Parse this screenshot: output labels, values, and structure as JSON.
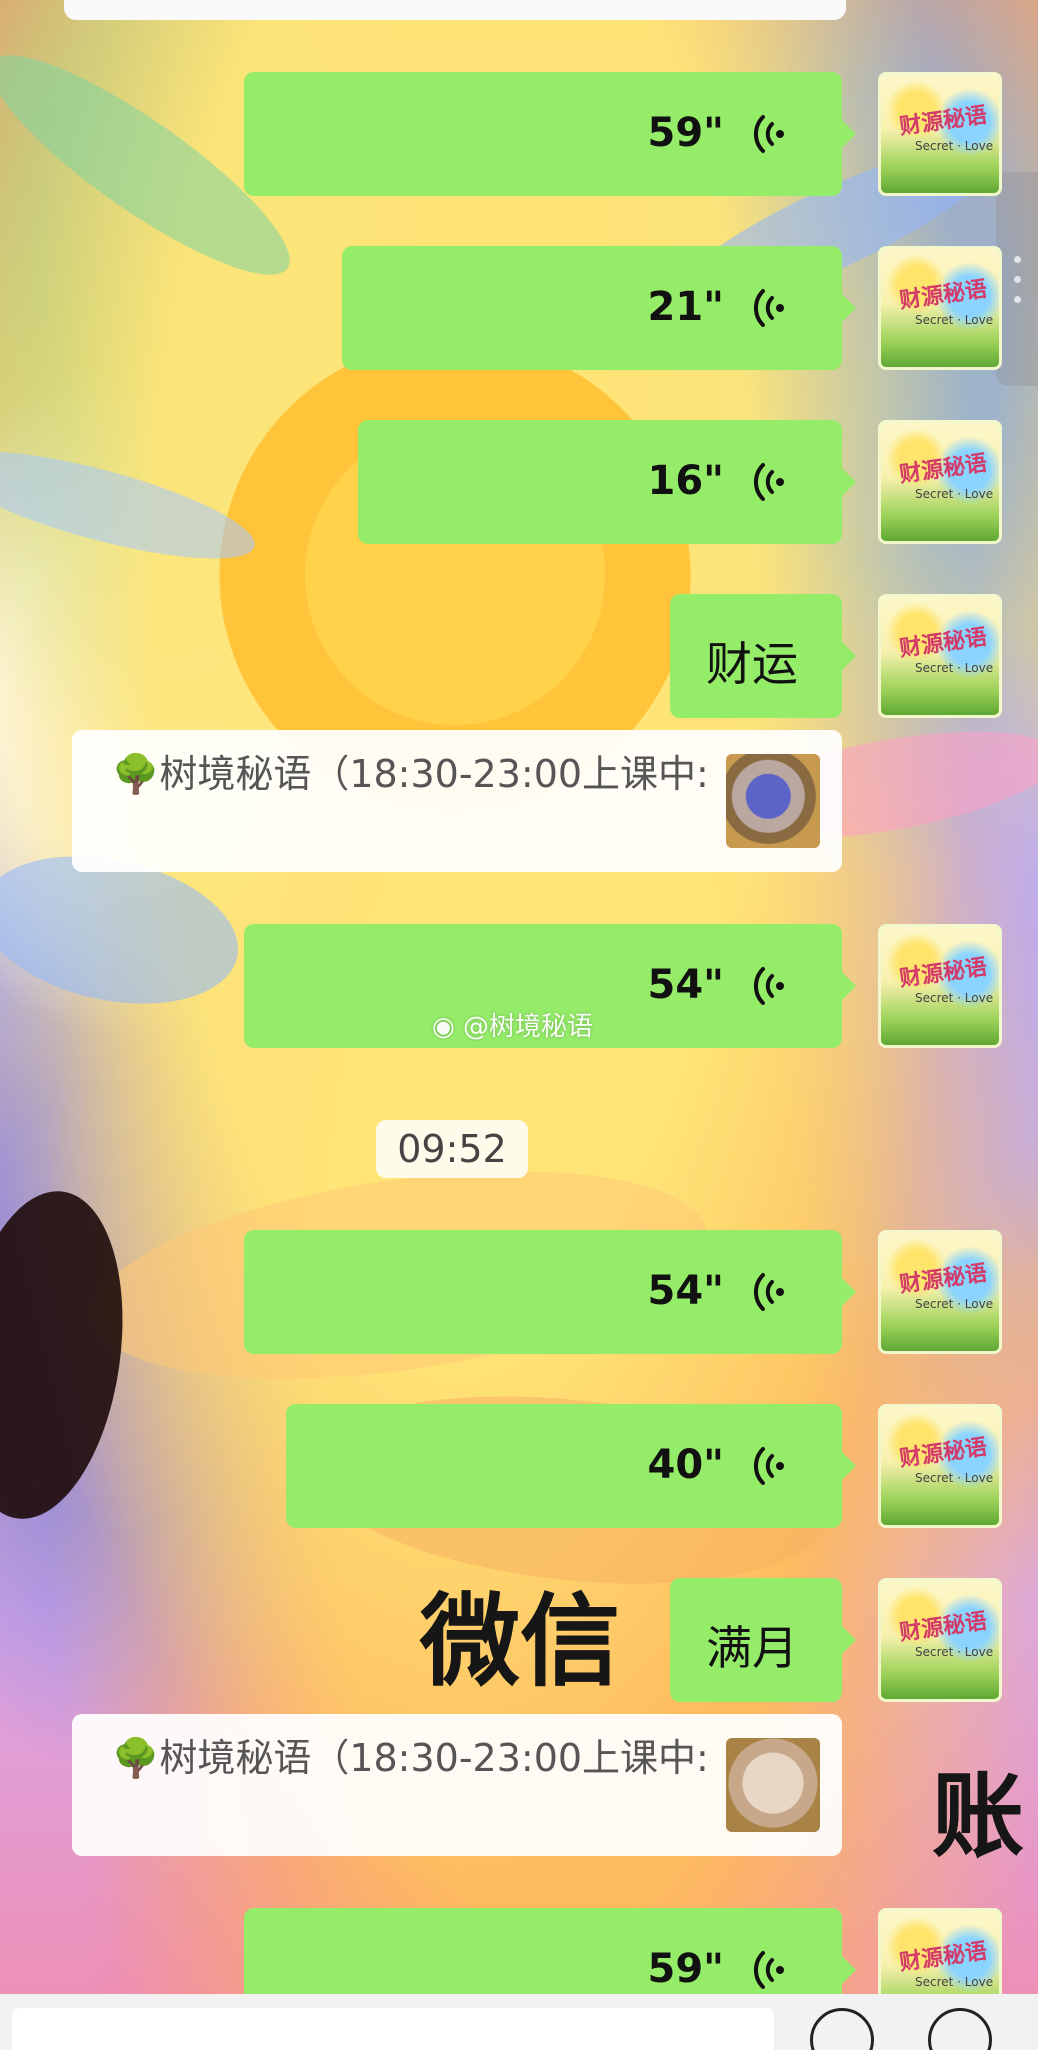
{
  "chat": {
    "messages": [
      {
        "type": "voice",
        "duration": "59\""
      },
      {
        "type": "voice",
        "duration": "21\""
      },
      {
        "type": "voice",
        "duration": "16\""
      },
      {
        "type": "text",
        "text": "财运"
      },
      {
        "type": "quote",
        "text": "🌳树境秘语（18:30-23:00上课中:"
      },
      {
        "type": "voice",
        "duration": "54\""
      },
      {
        "type": "time",
        "text": "09:52"
      },
      {
        "type": "voice",
        "duration": "54\""
      },
      {
        "type": "voice",
        "duration": "40\""
      },
      {
        "type": "text",
        "text": "满月"
      },
      {
        "type": "quote",
        "text": "🌳树境秘语（18:30-23:00上课中:"
      },
      {
        "type": "voice",
        "duration": "59\""
      }
    ],
    "voice_icon": "voice-wave-icon",
    "avatar_icon": "user-avatar"
  },
  "watermark": {
    "text": "@树境秘语"
  },
  "background_overlay": {
    "text_left": "微信",
    "text_right": "账"
  },
  "colors": {
    "bubble": "#95ec69",
    "card": "#ffffff"
  }
}
